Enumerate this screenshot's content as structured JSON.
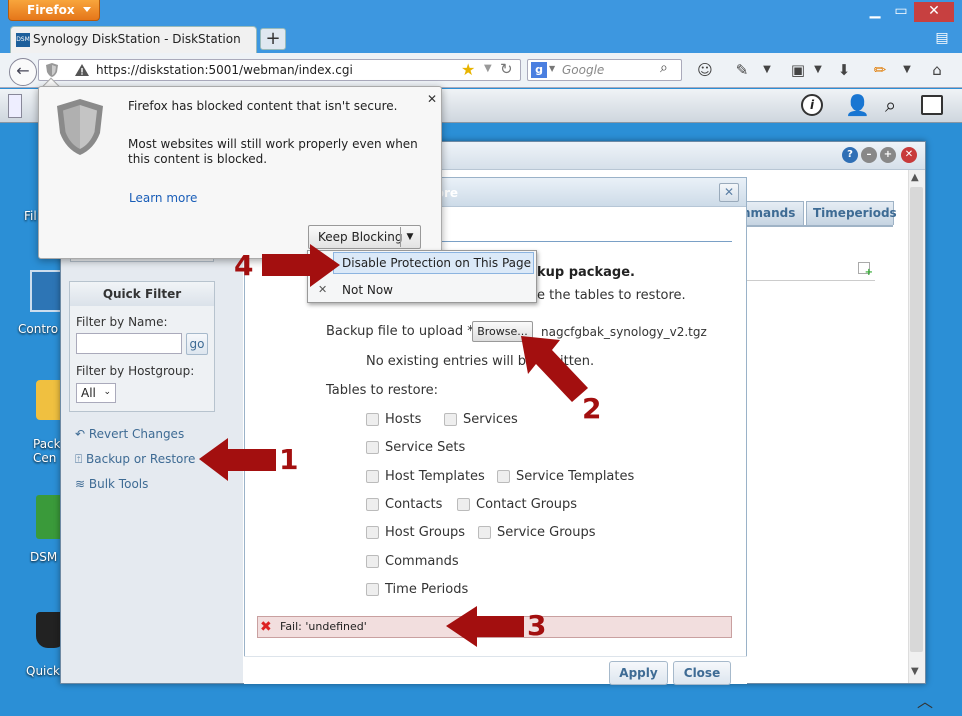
{
  "browser": {
    "menu_button": "Firefox",
    "tab_title": "Synology DiskStation - DiskStation",
    "favicon_text": "DSM",
    "url": "https://diskstation:5001/webman/index.cgi",
    "search_placeholder": "Google"
  },
  "desktop": {
    "icons": [
      "Fil",
      "Contro",
      "Pack\nCen",
      "DSM",
      "Quick"
    ]
  },
  "doorhanger": {
    "heading": "Firefox has blocked content that isn't secure.",
    "body": "Most websites will still work properly even when this content is blocked.",
    "learn_more": "Learn more",
    "keep_blocking": "Keep Blocking",
    "menu_items": [
      "Disable Protection on This Page",
      "Not Now"
    ]
  },
  "app": {
    "tabs": [
      "mmands",
      "Timeperiods"
    ],
    "quick_filter": {
      "title": "Quick Filter",
      "filter_by_name_label": "Filter by Name:",
      "go_button": "go",
      "filter_by_hostgroup_label": "Filter by Hostgroup:",
      "hostgroup_value": "All"
    },
    "links": [
      "Revert Changes",
      "Backup or Restore",
      "Bulk Tools"
    ]
  },
  "dialog": {
    "title_fragment": "tore",
    "heading_fragment": "kup package.",
    "instruction_fragment": "e the tables to restore.",
    "backup_label": "Backup file to upload *",
    "browse_button": "Browse...",
    "file_name": "nagcfgbak_synology_v2.tgz",
    "note_left": "No existing entries will be o",
    "note_right": "itten.",
    "tables_label": "Tables to restore:",
    "tables": [
      [
        "Hosts",
        "Services"
      ],
      [
        "Service Sets",
        ""
      ],
      [
        "Host Templates",
        "Service Templates"
      ],
      [
        "Contacts",
        "Contact Groups"
      ],
      [
        "Host Groups",
        "Service Groups"
      ],
      [
        "Commands",
        ""
      ],
      [
        "Time Periods",
        ""
      ]
    ],
    "fail_message": "Fail: 'undefined'",
    "apply_button": "Apply",
    "close_button": "Close"
  },
  "annotations": [
    "1",
    "2",
    "3",
    "4"
  ],
  "colors": {
    "annotation_red": "#a30f0f",
    "firefox_orange": "#e5761a",
    "link_blue": "#3e6b94"
  }
}
